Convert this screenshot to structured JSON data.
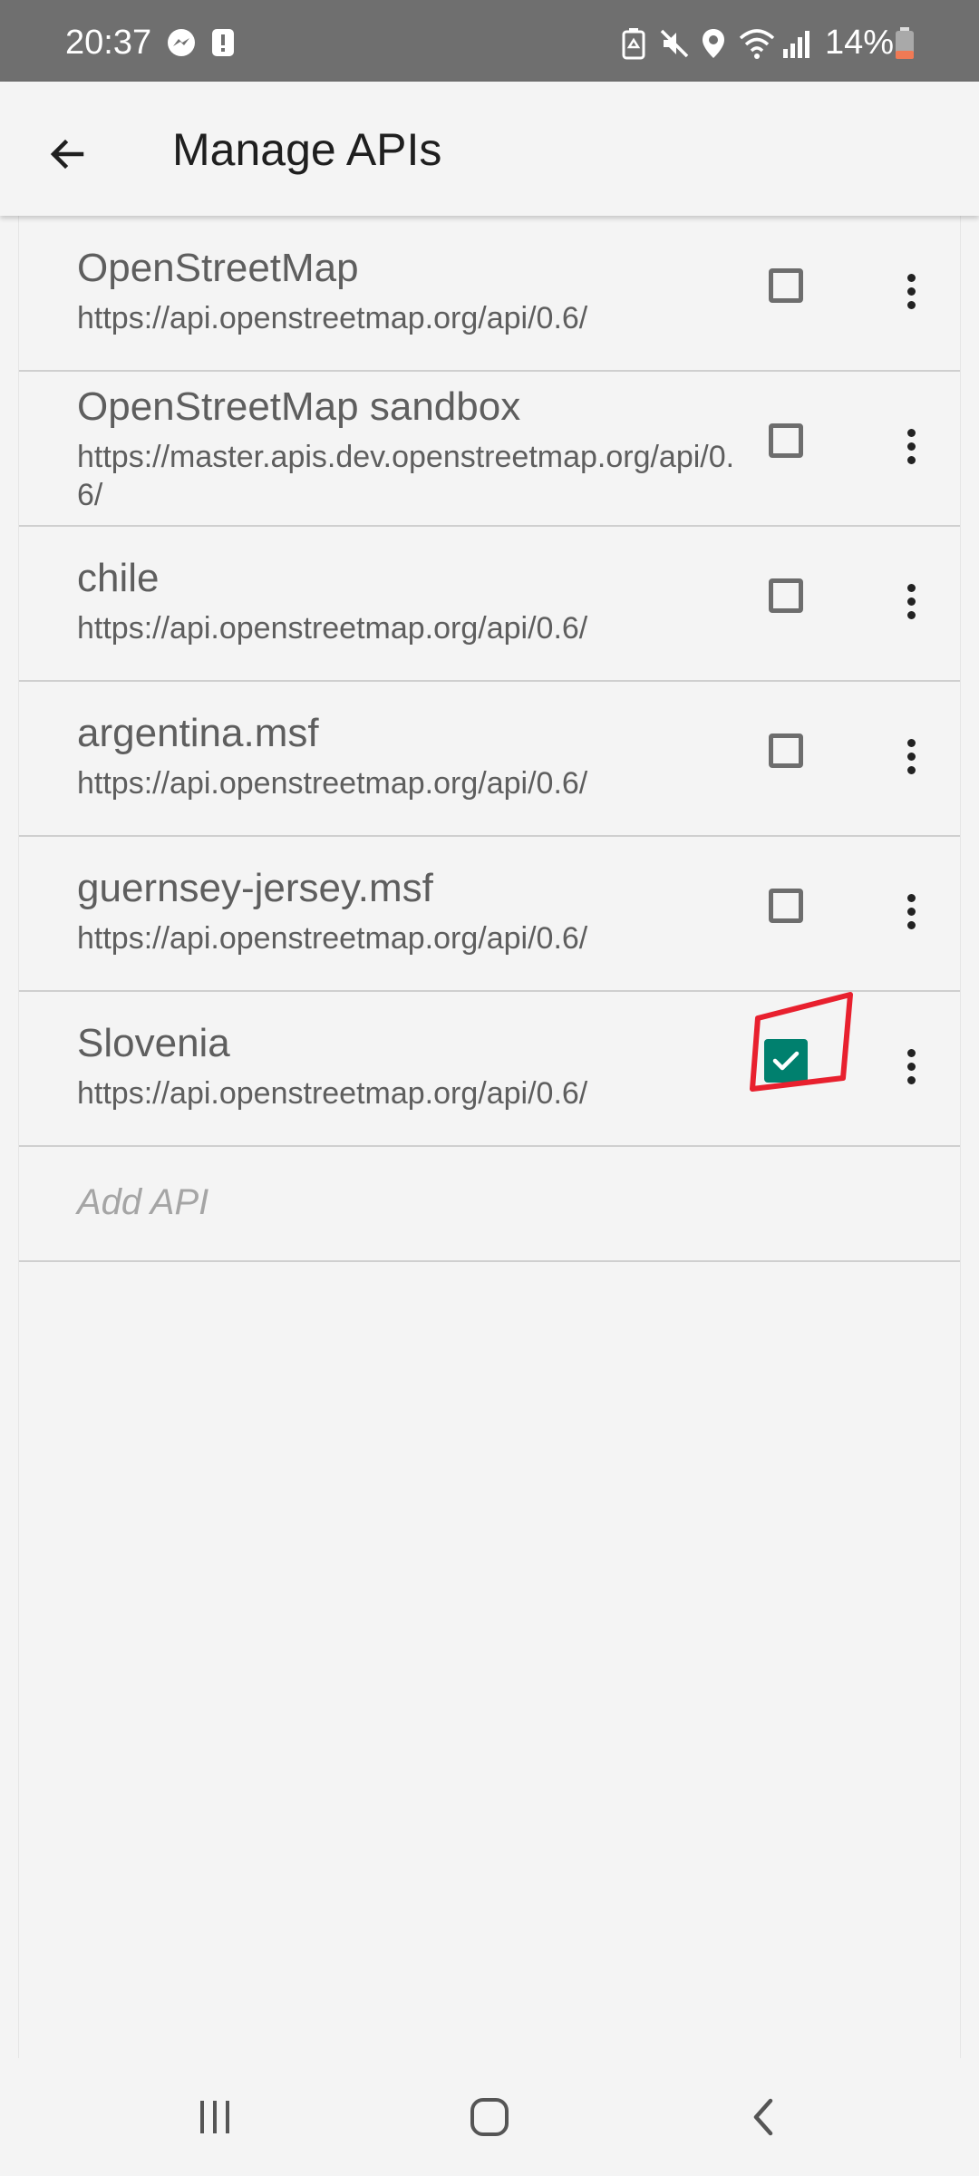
{
  "status_bar": {
    "time": "20:37",
    "battery": "14%",
    "icons_left": [
      "messenger-icon",
      "alert-icon"
    ],
    "icons_right": [
      "battery-saver-icon",
      "mute-icon",
      "location-icon",
      "wifi-icon",
      "signal-icon",
      "battery-icon"
    ]
  },
  "app_bar": {
    "title": "Manage APIs",
    "back_icon": "arrow-back-icon"
  },
  "apis": [
    {
      "name": "OpenStreetMap",
      "url": "https://api.openstreetmap.org/api/0.6/",
      "checked": false
    },
    {
      "name": "OpenStreetMap sandbox",
      "url": "https://master.apis.dev.openstreetmap.org/api/0.6/",
      "checked": false
    },
    {
      "name": "chile",
      "url": "https://api.openstreetmap.org/api/0.6/",
      "checked": false
    },
    {
      "name": "argentina.msf",
      "url": "https://api.openstreetmap.org/api/0.6/",
      "checked": false
    },
    {
      "name": "guernsey-jersey.msf",
      "url": "https://api.openstreetmap.org/api/0.6/",
      "checked": false
    },
    {
      "name": "Slovenia",
      "url": "https://api.openstreetmap.org/api/0.6/",
      "checked": true
    }
  ],
  "add_api": {
    "placeholder": "Add API"
  },
  "colors": {
    "accent": "#00806e",
    "highlight": "#e8202e"
  },
  "nav_bar": {
    "icons": [
      "recents-icon",
      "home-icon",
      "back-icon"
    ]
  }
}
